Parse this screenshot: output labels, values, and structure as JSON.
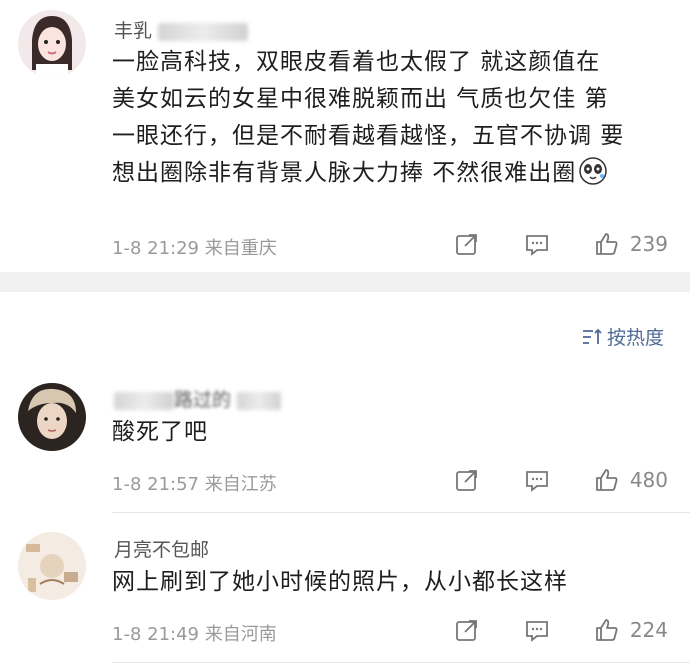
{
  "comments": [
    {
      "username": "丰乳",
      "text_lines": [
        "一脸高科技，双眼皮看着也太假了  就这颜值在",
        "美女如云的女星中很难脱颖而出  气质也欠佳  第",
        "一眼还行，但是不耐看越看越怪，五官不协调  要",
        "想出圈除非有背景人脉大力捧 不然很难出圈"
      ],
      "emoji": "panda-face-emoji",
      "timestamp": "1-8 21:29",
      "location": "来自重庆",
      "likes": "239"
    },
    {
      "username": "路过的",
      "text_lines": [
        "酸死了吧"
      ],
      "timestamp": "1-8 21:57",
      "location": "来自江苏",
      "likes": "480"
    },
    {
      "username": "月亮不包邮",
      "text_lines": [
        "网上刷到了她小时候的照片，从小都长这样"
      ],
      "timestamp": "1-8 21:49",
      "location": "来自河南",
      "likes": "224"
    }
  ],
  "sort": {
    "label": "按热度",
    "icon": "sort-icon"
  },
  "colors": {
    "link": "#4e6a96",
    "meta": "#9a9a9a",
    "separator": "#f1f1f1"
  }
}
